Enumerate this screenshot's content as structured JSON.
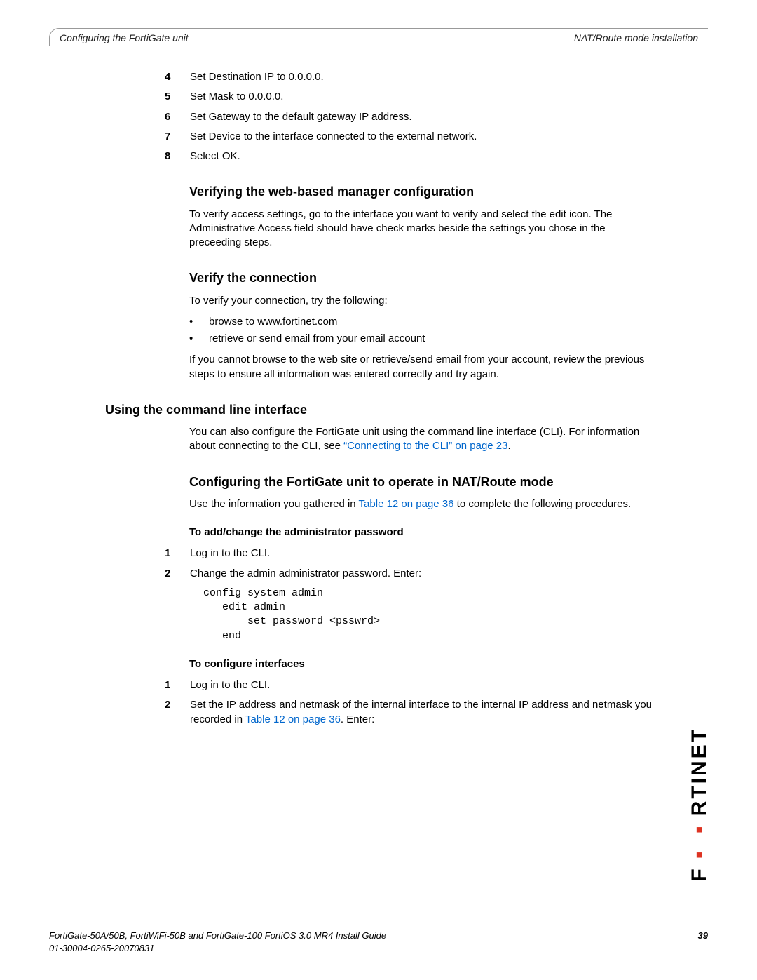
{
  "header": {
    "left": "Configuring the FortiGate unit",
    "right": "NAT/Route mode installation"
  },
  "steps_top": [
    {
      "n": "4",
      "t": "Set Destination IP to 0.0.0.0."
    },
    {
      "n": "5",
      "t": "Set Mask to 0.0.0.0."
    },
    {
      "n": "6",
      "t": "Set Gateway to the default gateway IP address."
    },
    {
      "n": "7",
      "t": "Set Device to the interface connected to the external network."
    },
    {
      "n": "8",
      "t": "Select OK."
    }
  ],
  "h_verify_web": "Verifying the web-based manager configuration",
  "p_verify_web": "To verify access settings, go to the interface you want to verify and select the edit icon. The Administrative Access field should have check marks beside the settings you chose in the preceeding steps.",
  "h_verify_conn": "Verify the connection",
  "p_verify_conn": "To verify your connection, try the following:",
  "bullets_conn": [
    "browse to www.fortinet.com",
    "retrieve or send email from your email account"
  ],
  "p_verify_conn2": "If you cannot browse to the web site or retrieve/send email from your account, review the previous steps to ensure all information was entered correctly and try again.",
  "h_cli": "Using the command line interface",
  "p_cli_pre": "You can also configure the FortiGate unit using the command line interface (CLI). For information about connecting to the CLI, see ",
  "link_cli": "“Connecting to the CLI” on page 23",
  "p_cli_post": ".",
  "h_nat": "Configuring the FortiGate unit to operate in NAT/Route mode",
  "p_nat_pre": "Use the information you gathered in ",
  "link_nat": "Table 12 on page 36",
  "p_nat_post": " to complete the following procedures.",
  "sub_admin": "To add/change the administrator password",
  "steps_admin": [
    {
      "n": "1",
      "t": "Log in to the CLI."
    },
    {
      "n": "2",
      "t": "Change the admin administrator password. Enter:"
    }
  ],
  "code_admin": "config system admin\n   edit admin\n       set password <psswrd>\n   end",
  "sub_if": "To configure interfaces",
  "steps_if": [
    {
      "n": "1",
      "t": "Log in to the CLI."
    }
  ],
  "step_if2_n": "2",
  "step_if2_pre": "Set the IP address and netmask of the internal interface to the internal IP address and netmask you recorded in ",
  "step_if2_link": "Table 12 on page 36",
  "step_if2_post": ". Enter:",
  "footer": {
    "line1": "FortiGate-50A/50B, FortiWiFi-50B and FortiGate-100 FortiOS 3.0 MR4 Install Guide",
    "line2": "01-30004-0265-20070831",
    "page": "39"
  },
  "logo_text": "FORTINET"
}
